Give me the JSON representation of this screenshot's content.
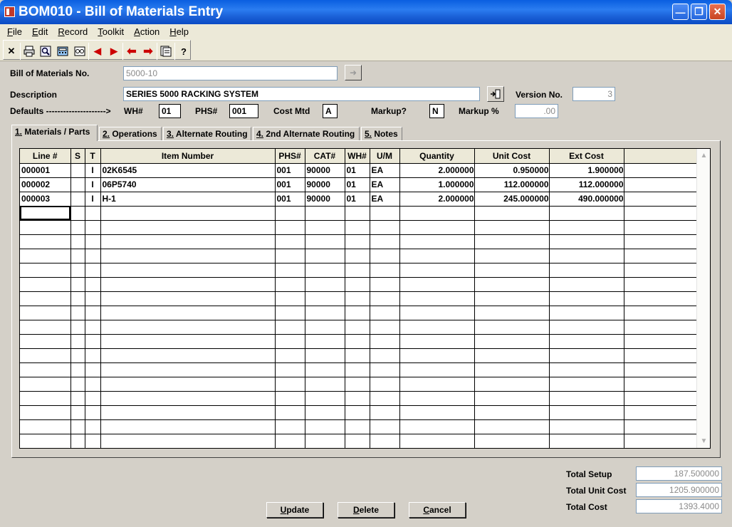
{
  "window": {
    "title": "BOM010 - Bill of Materials Entry"
  },
  "menu": [
    "File",
    "Edit",
    "Record",
    "Toolkit",
    "Action",
    "Help"
  ],
  "header": {
    "bom_no_label": "Bill of Materials No.",
    "bom_no_value": "5000-10",
    "description_label": "Description",
    "description_value": "SERIES 5000 RACKING SYSTEM",
    "version_label": "Version No.",
    "version_value": "3",
    "defaults_label": "Defaults --------------------->",
    "wh_label": "WH#",
    "wh_value": "01",
    "phs_label": "PHS#",
    "phs_value": "001",
    "costmtd_label": "Cost Mtd",
    "costmtd_value": "A",
    "markupq_label": "Markup?",
    "markupq_value": "N",
    "markuppct_label": "Markup %",
    "markuppct_value": ".00"
  },
  "tabs": [
    "1. Materials / Parts",
    "2. Operations",
    "3. Alternate Routing",
    "4. 2nd Alternate Routing",
    "5. Notes"
  ],
  "grid": {
    "columns": [
      "Line #",
      "S",
      "T",
      "Item Number",
      "PHS#",
      "CAT#",
      "WH#",
      "U/M",
      "Quantity",
      "Unit Cost",
      "Ext Cost",
      ""
    ],
    "rows": [
      [
        "000001",
        "",
        "I",
        "02K6545",
        "001",
        "90000",
        "01",
        "EA",
        "2.000000",
        "0.950000",
        "1.900000",
        ""
      ],
      [
        "000002",
        "",
        "I",
        "06P5740",
        "001",
        "90000",
        "01",
        "EA",
        "1.000000",
        "112.000000",
        "112.000000",
        ""
      ],
      [
        "000003",
        "",
        "I",
        "H-1",
        "001",
        "90000",
        "01",
        "EA",
        "2.000000",
        "245.000000",
        "490.000000",
        ""
      ]
    ]
  },
  "totals": {
    "setup_label": "Total Setup",
    "setup_value": "187.500000",
    "unitcost_label": "Total Unit Cost",
    "unitcost_value": "1205.900000",
    "cost_label": "Total Cost",
    "cost_value": "1393.4000"
  },
  "buttons": {
    "update": "Update",
    "delete": "Delete",
    "cancel": "Cancel"
  },
  "toolbar_icons": [
    "close-icon",
    "print-icon",
    "find-icon",
    "calculator-icon",
    "browse-icon",
    "prev-icon",
    "next-icon",
    "first-icon",
    "last-icon",
    "notes-icon",
    "help-icon"
  ]
}
